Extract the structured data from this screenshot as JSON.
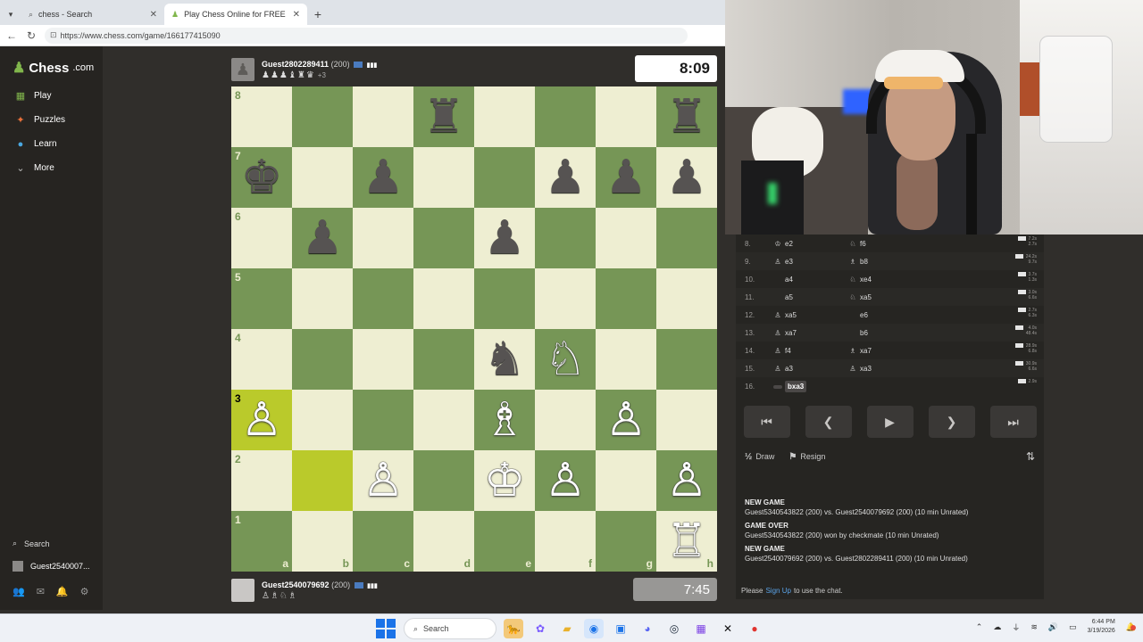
{
  "browser": {
    "tabs": [
      {
        "title": "chess - Search",
        "active": false
      },
      {
        "title": "Play Chess Online for FREE - 2 Pla",
        "active": true
      }
    ],
    "url": "https://www.chess.com/game/166177415090"
  },
  "sidebar": {
    "logo": "Chess",
    "logo_suffix": ".com",
    "items": [
      {
        "label": "Play",
        "icon": "play-board-icon"
      },
      {
        "label": "Puzzles",
        "icon": "puzzle-icon"
      },
      {
        "label": "Learn",
        "icon": "learn-icon"
      },
      {
        "label": "More",
        "icon": "chevron-down-icon"
      }
    ],
    "search_label": "Search",
    "user_label": "Guest2540007..."
  },
  "top_player": {
    "name": "Guest2802289411",
    "rating": "(200)",
    "captured": "♟♟♟♝♜♛",
    "advantage": "+3",
    "clock": "8:09"
  },
  "bottom_player": {
    "name": "Guest2540079692",
    "rating": "(200)",
    "captured": "♙♗♘♗",
    "clock": "7:45"
  },
  "board": {
    "ranks": [
      "8",
      "7",
      "6",
      "5",
      "4",
      "3",
      "2",
      "1"
    ],
    "files": [
      "a",
      "b",
      "c",
      "d",
      "e",
      "f",
      "g",
      "h"
    ],
    "highlighted": [
      "a3",
      "b2"
    ],
    "pieces": {
      "d8": {
        "glyph": "♜",
        "color": "b"
      },
      "h8": {
        "glyph": "♜",
        "color": "b"
      },
      "a7": {
        "glyph": "♚",
        "color": "b"
      },
      "c7": {
        "glyph": "♟",
        "color": "b"
      },
      "f7": {
        "glyph": "♟",
        "color": "b"
      },
      "g7": {
        "glyph": "♟",
        "color": "b"
      },
      "h7": {
        "glyph": "♟",
        "color": "b"
      },
      "b6": {
        "glyph": "♟",
        "color": "b"
      },
      "e6": {
        "glyph": "♟",
        "color": "b"
      },
      "e4": {
        "glyph": "♞",
        "color": "b"
      },
      "f4": {
        "glyph": "♘",
        "color": "w"
      },
      "a3": {
        "glyph": "♙",
        "color": "w"
      },
      "e3": {
        "glyph": "♗",
        "color": "w"
      },
      "g3": {
        "glyph": "♙",
        "color": "w"
      },
      "c2": {
        "glyph": "♙",
        "color": "w"
      },
      "e2": {
        "glyph": "♔",
        "color": "w"
      },
      "f2": {
        "glyph": "♙",
        "color": "w"
      },
      "h2": {
        "glyph": "♙",
        "color": "w"
      },
      "h1": {
        "glyph": "♖",
        "color": "w"
      }
    }
  },
  "moves": [
    {
      "num": "8.",
      "white_icon": "♔",
      "white": "e2",
      "black_icon": "♘",
      "black": "f6"
    },
    {
      "num": "9.",
      "white_icon": "♙",
      "white": "e3",
      "black_icon": "♗",
      "black": "b8"
    },
    {
      "num": "10.",
      "white_icon": "",
      "white": "a4",
      "black_icon": "♘",
      "black": "xe4"
    },
    {
      "num": "11.",
      "white_icon": "",
      "white": "a5",
      "black_icon": "♘",
      "black": "xa5"
    },
    {
      "num": "12.",
      "white_icon": "♙",
      "white": "xa5",
      "black_icon": "",
      "black": "e6"
    },
    {
      "num": "13.",
      "white_icon": "♙",
      "white": "xa7",
      "black_icon": "",
      "black": "b6"
    },
    {
      "num": "14.",
      "white_icon": "♙",
      "white": "f4",
      "black_icon": "♗",
      "black": "xa7"
    },
    {
      "num": "15.",
      "white_icon": "♙",
      "white": "a3",
      "black_icon": "♙",
      "black": "xa3"
    },
    {
      "num": "16.",
      "white_icon": "",
      "white": "bxa3",
      "black_icon": "",
      "black": "",
      "current": true
    }
  ],
  "move_times": [
    [
      "7.2s",
      "2.7s"
    ],
    [
      "24.2s",
      "9.7s"
    ],
    [
      "3.7s",
      "1.3s"
    ],
    [
      "3.0s",
      "6.6s"
    ],
    [
      "2.7s",
      "6.3s"
    ],
    [
      "4.0s",
      "48.4s"
    ],
    [
      "28.9s",
      "6.8s"
    ],
    [
      "30.9s",
      "6.6s"
    ],
    [
      "2.9s",
      ""
    ]
  ],
  "controls": {
    "first": "⏮",
    "prev": "❮",
    "play": "▶",
    "next": "❯",
    "last": "⏭"
  },
  "actions": {
    "draw_icon": "½",
    "draw": "Draw",
    "resign": "Resign"
  },
  "game_log": [
    {
      "title": "NEW GAME",
      "text": "Guest5340543822 (200) vs. Guest2540079692 (200) (10 min Unrated)"
    },
    {
      "title": "GAME OVER",
      "text": "Guest5340543822 (200) won by checkmate (10 min Unrated)"
    },
    {
      "title": "NEW GAME",
      "text": "Guest2540079692 (200) vs. Guest2802289411 (200) (10 min Unrated)"
    }
  ],
  "chat": {
    "prefix": "Please",
    "link": "Sign Up",
    "suffix": "to use the chat."
  },
  "taskbar": {
    "search": "Search",
    "time": "6:44 PM",
    "date": "3/19/2026"
  },
  "colors": {
    "board_light": "#eeeed2",
    "board_dark": "#769656",
    "highlight_light": "#f6f669",
    "highlight_dark": "#baca2b",
    "accent_green": "#81b64c"
  }
}
